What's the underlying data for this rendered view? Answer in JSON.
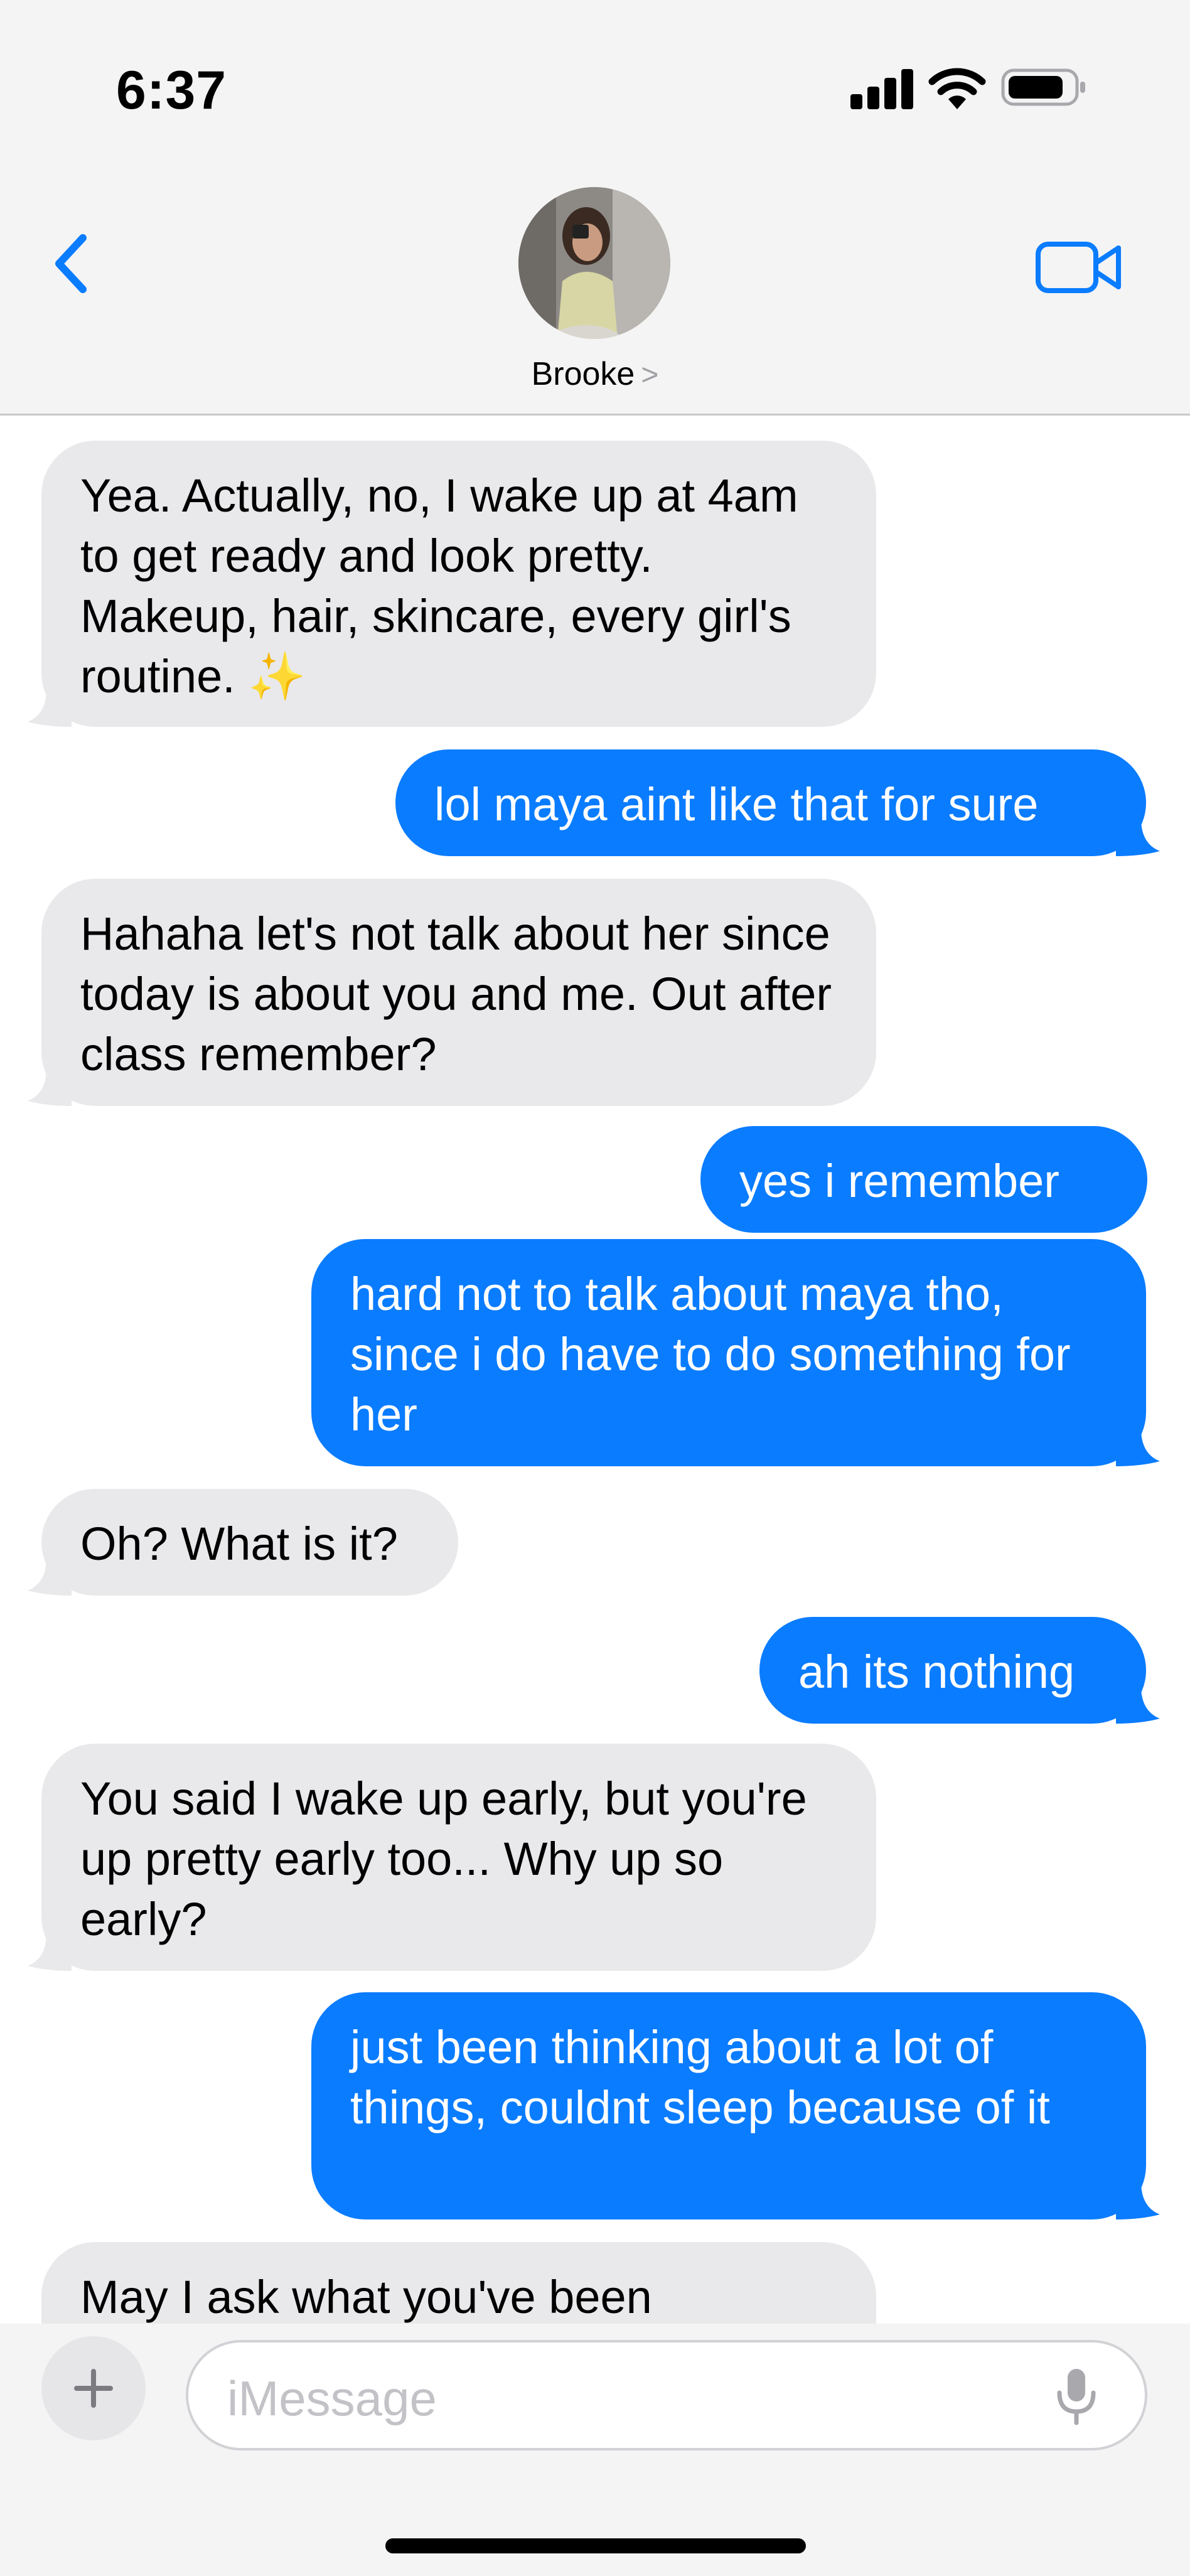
{
  "status_bar": {
    "time": "6:37"
  },
  "header": {
    "contact_name": "Brooke",
    "contact_chevron": ">",
    "icons": {
      "back": "chevron-left-icon",
      "video": "video-camera-icon"
    },
    "accent_color": "#0a7cff"
  },
  "messages": [
    {
      "direction": "incoming",
      "text": "Yea. Actually, no, I wake up at 4am to get ready and look pretty. Makeup, hair, skincare, every girl's routine. ✨"
    },
    {
      "direction": "outgoing",
      "text": "lol maya aint like that for sure"
    },
    {
      "direction": "incoming",
      "text": "Hahaha let's not talk about her since today is about you and me. Out after class remember?"
    },
    {
      "direction": "outgoing",
      "text": "yes i remember"
    },
    {
      "direction": "outgoing",
      "text": "hard not to talk about maya tho, since i do have to do something for her"
    },
    {
      "direction": "incoming",
      "text": "Oh? What is it?"
    },
    {
      "direction": "outgoing",
      "text": "ah its nothing"
    },
    {
      "direction": "incoming",
      "text": "You said I wake up early, but you're up pretty early too... Why up so early?"
    },
    {
      "direction": "outgoing",
      "text": "just been thinking about a lot of things, couldnt sleep because of it"
    },
    {
      "direction": "incoming",
      "text": "May I ask what you've been"
    }
  ],
  "composer": {
    "placeholder": "iMessage",
    "icons": {
      "add": "plus-icon",
      "mic": "microphone-icon"
    }
  },
  "colors": {
    "incoming_bubble": "#e9e9eb",
    "outgoing_bubble": "#0a7cff"
  }
}
